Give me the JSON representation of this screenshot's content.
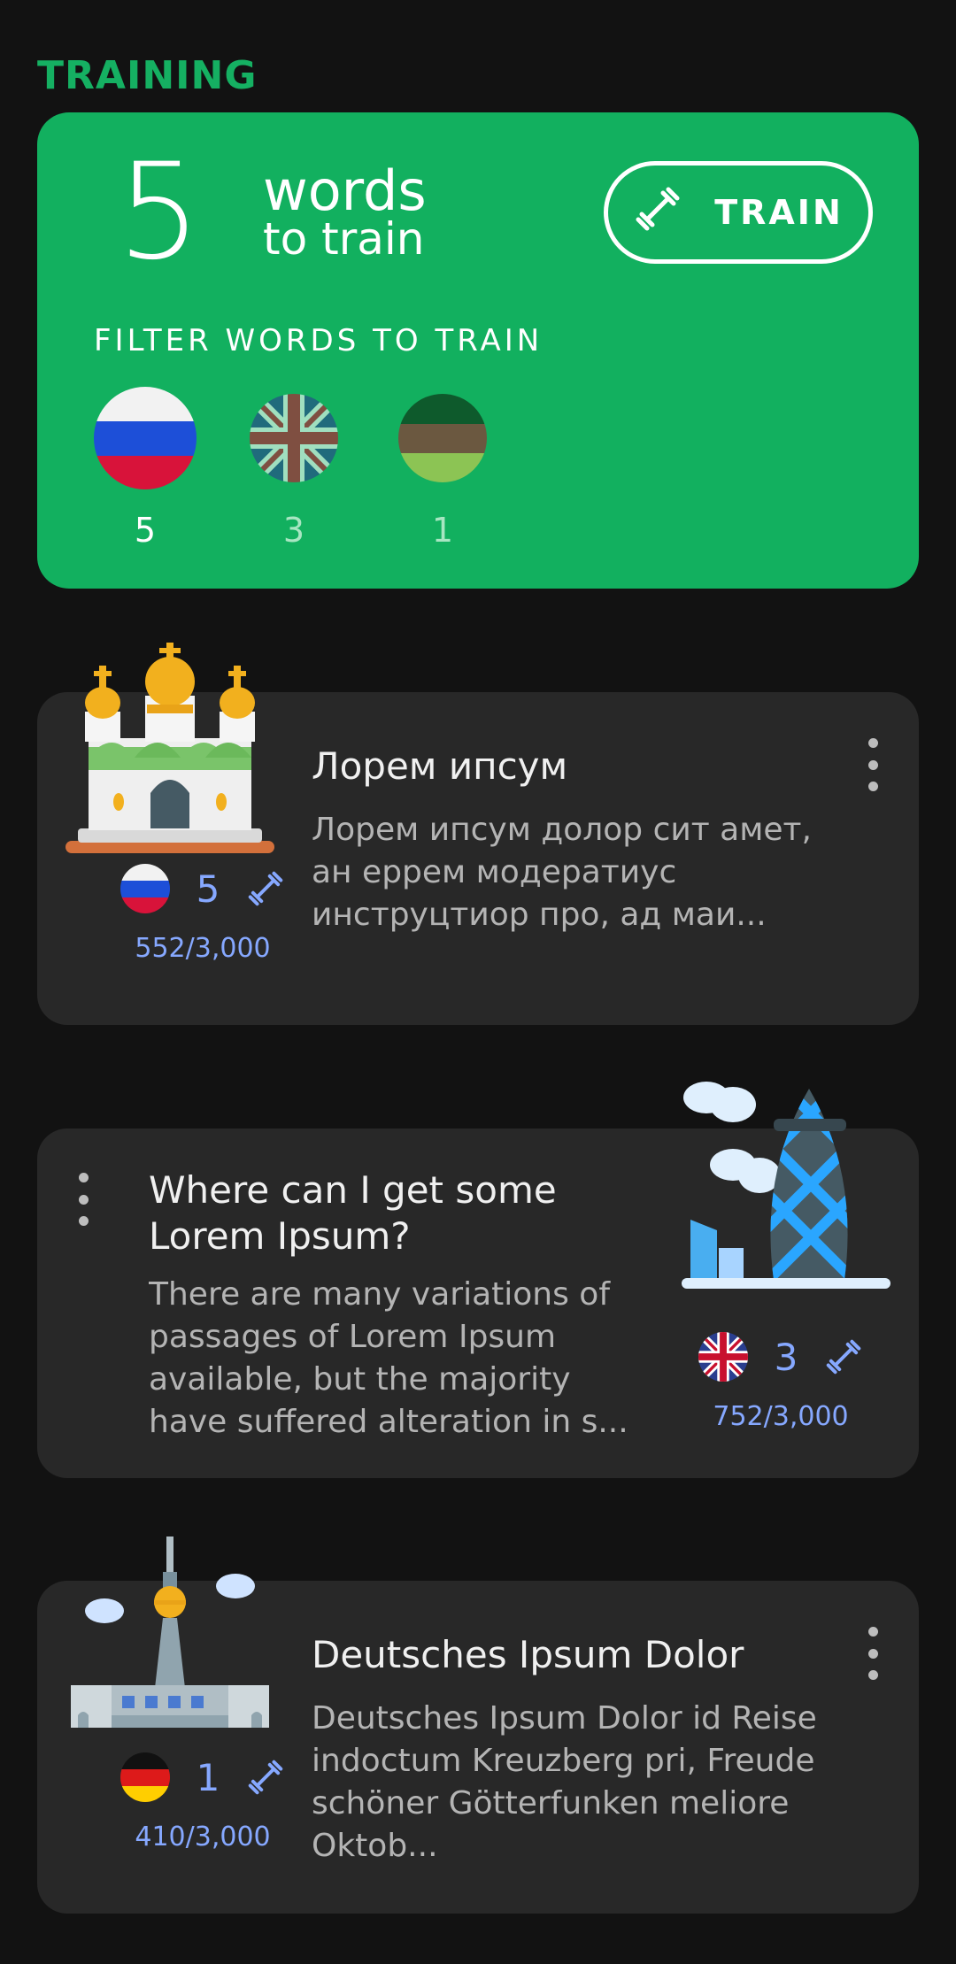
{
  "section": {
    "title": "TRAINING"
  },
  "train": {
    "count": "5",
    "words_label": "words",
    "to_train_label": "to train",
    "button_label": "TRAIN",
    "filter_label": "FILTER WORDS TO TRAIN",
    "languages": [
      {
        "flag": "russia-flag-icon",
        "count": "5",
        "selected": true
      },
      {
        "flag": "uk-flag-icon",
        "count": "3",
        "selected": false
      },
      {
        "flag": "tricolor-flag-icon",
        "count": "1",
        "selected": false
      }
    ]
  },
  "decks": [
    {
      "title": "Лорем ипсум",
      "description": "Лорем ипсум долор сит амет, ан еррем модератиус инструцтиор про, ад маи...",
      "flag": "russia-flag-icon",
      "words": "5",
      "progress": "552/3,000",
      "illustration": "church-icon"
    },
    {
      "title": "Where can I get some Lorem Ipsum?",
      "description": "There are many variations of passages of Lorem Ipsum available, but the majority have suffered alteration in s...",
      "flag": "uk-flag-icon",
      "words": "3",
      "progress": "752/3,000",
      "illustration": "gherkin-tower-icon"
    },
    {
      "title": "Deutsches Ipsum Dolor",
      "description": "Deutsches Ipsum Dolor id Reise indoctum Kreuzberg pri, Freude schöner Götterfunken meliore Oktob...",
      "flag": "germany-flag-icon",
      "words": "1",
      "progress": "410/3,000",
      "illustration": "tv-tower-icon"
    }
  ],
  "colors": {
    "accent": "#12b05f",
    "title_green": "#15b062",
    "stat_blue": "#86a8ff",
    "card": "#282828",
    "background": "#121212"
  }
}
